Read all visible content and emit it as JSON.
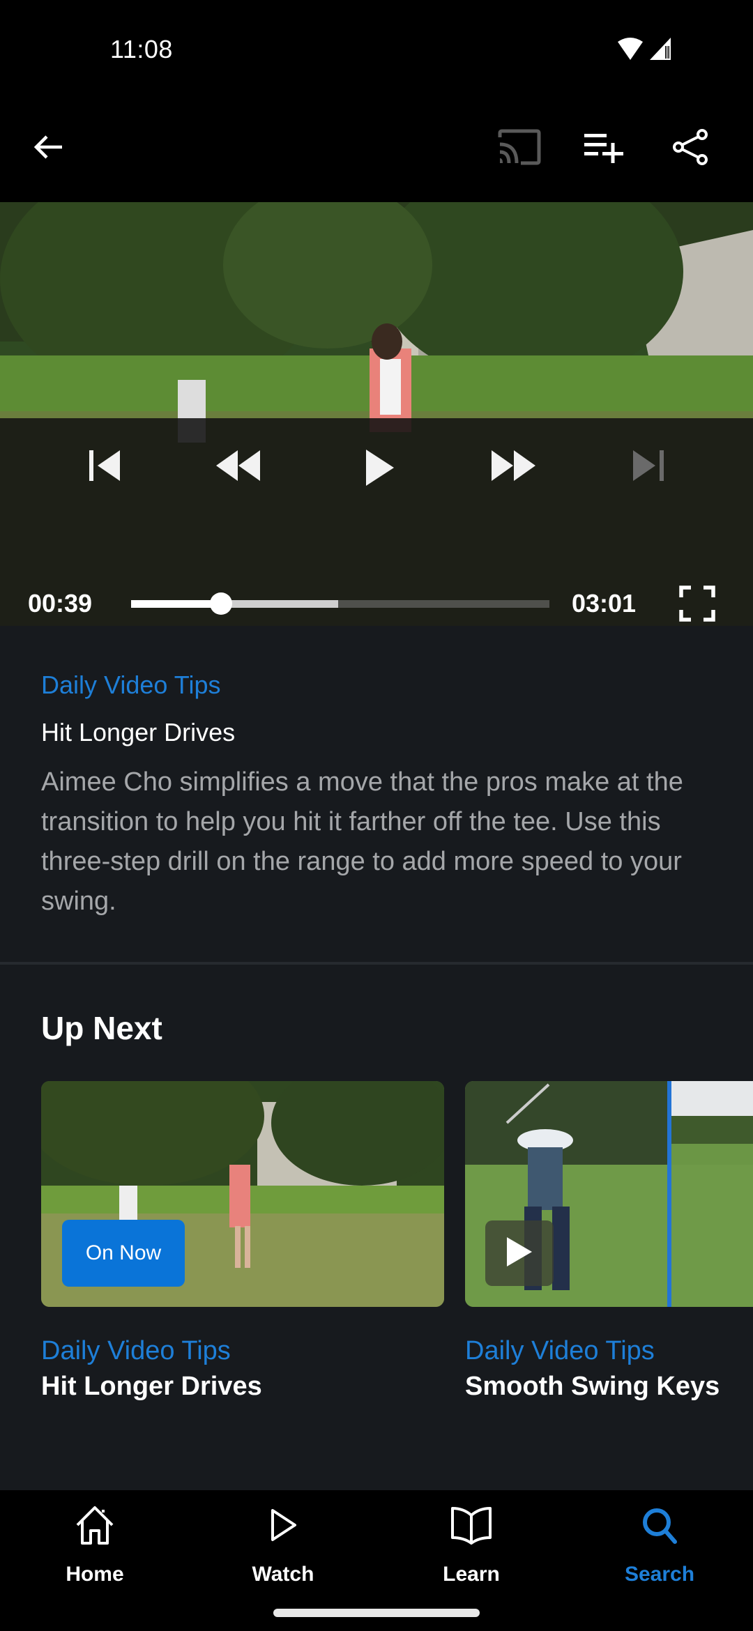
{
  "status_bar": {
    "time": "11:08",
    "icons": [
      "wifi-icon",
      "cell-signal-icon"
    ]
  },
  "app_bar": {
    "back_icon": "arrow-left-icon",
    "actions": [
      {
        "name": "cast",
        "icon": "cast-icon",
        "enabled": false
      },
      {
        "name": "add-to-queue",
        "icon": "playlist-add-icon",
        "enabled": true
      },
      {
        "name": "share",
        "icon": "share-icon",
        "enabled": true
      }
    ]
  },
  "player": {
    "current_time": "00:39",
    "duration": "03:01",
    "played_fraction": 0.215,
    "buffered_fraction": 0.495,
    "controls": [
      {
        "name": "previous",
        "icon": "skip-previous-icon",
        "enabled": true
      },
      {
        "name": "rewind",
        "icon": "rewind-icon",
        "enabled": true
      },
      {
        "name": "play",
        "icon": "play-icon",
        "enabled": true
      },
      {
        "name": "fast-forward",
        "icon": "fast-forward-icon",
        "enabled": true
      },
      {
        "name": "next",
        "icon": "skip-next-icon",
        "enabled": false
      }
    ],
    "fullscreen_icon": "fullscreen-icon"
  },
  "info": {
    "category": "Daily Video Tips",
    "title": "Hit Longer Drives",
    "description": "Aimee Cho simplifies a move that the pros make at the transition to help you hit it farther off the tee. Use this three-step drill on the range to add more speed to your swing."
  },
  "up_next": {
    "heading": "Up Next",
    "items": [
      {
        "category": "Daily Video Tips",
        "title": "Hit Longer Drives",
        "badge": "On Now"
      },
      {
        "category": "Daily Video Tips",
        "title": "Smooth Swing Keys",
        "badge": null
      }
    ]
  },
  "bottom_nav": {
    "items": [
      {
        "label": "Home",
        "icon": "home-icon",
        "active": false
      },
      {
        "label": "Watch",
        "icon": "play-outline-icon",
        "active": false
      },
      {
        "label": "Learn",
        "icon": "book-icon",
        "active": false
      },
      {
        "label": "Search",
        "icon": "search-icon",
        "active": true
      }
    ]
  },
  "colors": {
    "accent": "#1e7fd8",
    "background": "#171a1e",
    "on_now_badge": "#0a74d8",
    "description_text": "#a5a7aa"
  }
}
